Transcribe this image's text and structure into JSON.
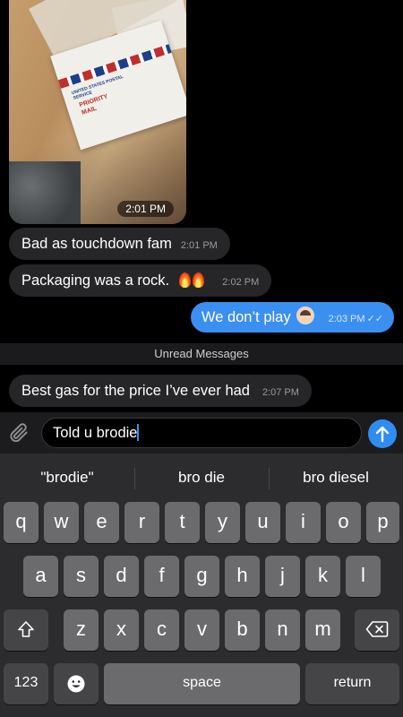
{
  "messages": [
    {
      "type": "photo",
      "time": "2:01 PM"
    },
    {
      "type": "incoming",
      "text": "Bad as touchdown fam",
      "time": "2:01 PM"
    },
    {
      "type": "incoming",
      "text": "Packaging was a rock.",
      "time": "2:02 PM",
      "emoji": "fire fire"
    },
    {
      "type": "outgoing",
      "text": "We don’t play",
      "time": "2:03 PM",
      "emoji": "facepalm",
      "status": "read"
    },
    {
      "type": "incoming",
      "text": "Best gas for the price I’ve ever had",
      "time": "2:07 PM"
    }
  ],
  "photo_labels": {
    "usps": "UNITED STATES POSTAL SERVICE",
    "priority": "PRIORITY MAIL"
  },
  "unread_divider": "Unread Messages",
  "composer": {
    "value": "Told u brodie",
    "attach_icon": "paperclip-icon",
    "send_icon": "arrow-up-icon"
  },
  "suggestions": [
    "\"brodie\"",
    "bro die",
    "bro diesel"
  ],
  "keyboard": {
    "row1": [
      "q",
      "w",
      "e",
      "r",
      "t",
      "y",
      "u",
      "i",
      "o",
      "p"
    ],
    "row2": [
      "a",
      "s",
      "d",
      "f",
      "g",
      "h",
      "j",
      "k",
      "l"
    ],
    "row3": [
      "z",
      "x",
      "c",
      "v",
      "b",
      "n",
      "m"
    ],
    "numbers_key": "123",
    "space_key": "space",
    "return_key": "return",
    "shift_icon": "shift-icon",
    "delete_icon": "backspace-icon",
    "emoji_icon": "emoji-icon"
  }
}
